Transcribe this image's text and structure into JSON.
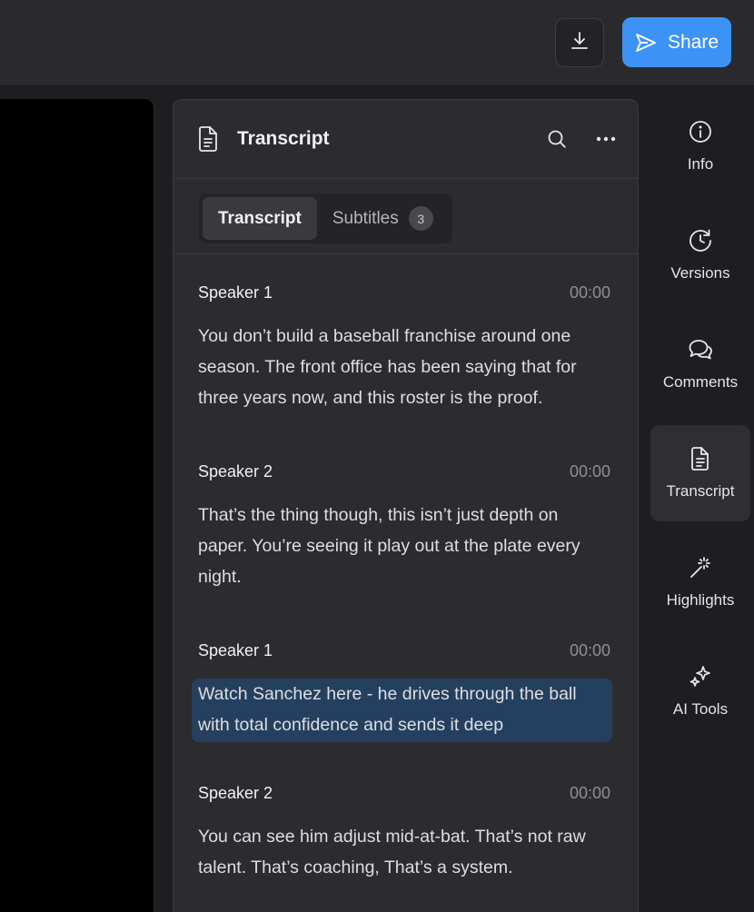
{
  "topbar": {
    "download_icon": "download-icon",
    "share_label": "Share",
    "share_icon": "send-icon",
    "accent": "#3d93f5"
  },
  "panel": {
    "title": "Transcript",
    "title_icon": "document-icon",
    "tabs": [
      {
        "label": "Transcript",
        "active": true
      },
      {
        "label": "Subtitles",
        "badge": "3",
        "active": false
      }
    ],
    "entries": [
      {
        "speaker": "Speaker 1",
        "time": "00:00",
        "text": "You don’t build a baseball franchise around one season. The front office has been saying that for three years now, and this roster is the proof."
      },
      {
        "speaker": "Speaker 2",
        "time": "00:00",
        "text": "That’s the thing though, this isn’t just depth on paper. You’re seeing it play out at the plate every night."
      },
      {
        "speaker": "Speaker 1",
        "time": "00:00",
        "text": "Watch Sanchez here - he drives through the ball with total confidence and sends it deep",
        "highlighted": true
      },
      {
        "speaker": "Speaker 2",
        "time": "00:00",
        "text": "You can see him adjust mid-at-bat. That’s not raw talent. That’s coaching, That’s a system."
      }
    ]
  },
  "sidebar": {
    "items": [
      {
        "label": "Info",
        "icon": "info-icon"
      },
      {
        "label": "Versions",
        "icon": "history-icon"
      },
      {
        "label": "Comments",
        "icon": "comments-icon"
      },
      {
        "label": "Transcript",
        "icon": "transcript-icon",
        "active": true
      },
      {
        "label": "Highlights",
        "icon": "magic-wand-icon"
      },
      {
        "label": "AI Tools",
        "icon": "sparkles-icon"
      }
    ]
  }
}
